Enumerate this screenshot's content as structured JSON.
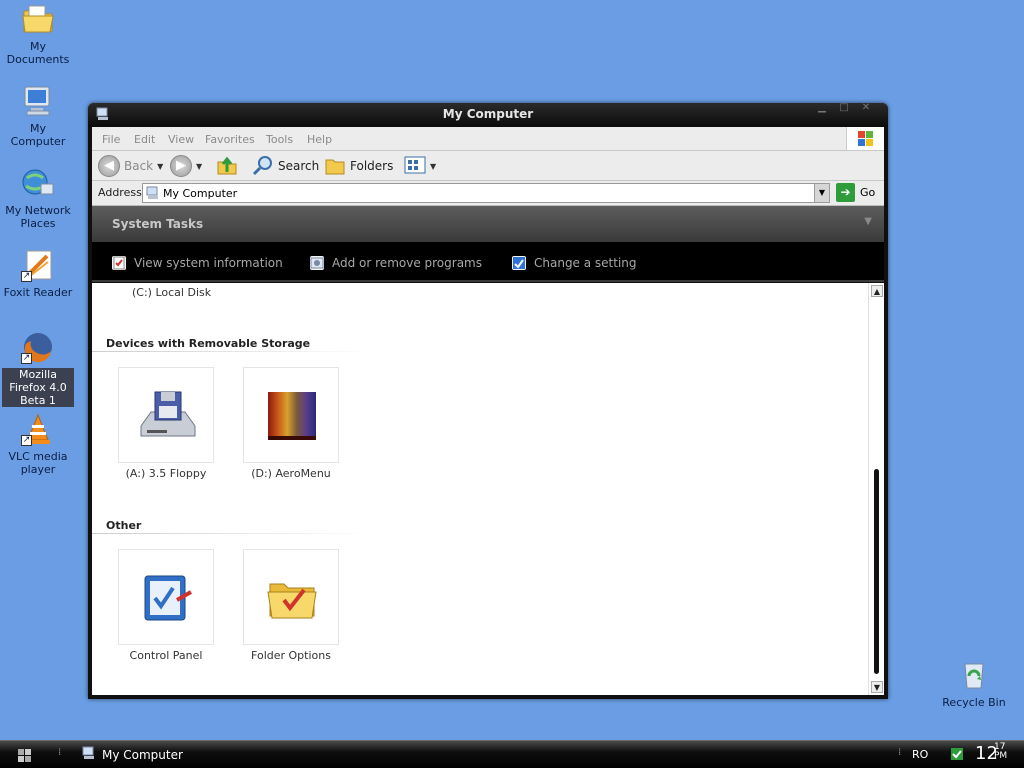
{
  "desktop": {
    "icons": [
      {
        "label": "My Documents",
        "icon": "folder-documents-icon"
      },
      {
        "label": "My Computer",
        "icon": "computer-icon"
      },
      {
        "label": "My Network Places",
        "icon": "network-places-icon"
      },
      {
        "label": "Foxit Reader",
        "icon": "foxit-reader-icon"
      },
      {
        "label": "Mozilla Firefox 4.0 Beta 1",
        "icon": "firefox-icon"
      },
      {
        "label": "VLC media player",
        "icon": "vlc-icon"
      },
      {
        "label": "Recycle Bin",
        "icon": "recycle-bin-icon"
      }
    ],
    "background_color": "#6a9de3"
  },
  "window": {
    "title": "My Computer",
    "menu": [
      "File",
      "Edit",
      "View",
      "Favorites",
      "Tools",
      "Help"
    ],
    "toolbar": {
      "back": "Back",
      "search": "Search",
      "folders": "Folders"
    },
    "address": {
      "label": "Address",
      "value": "My Computer",
      "go": "Go"
    },
    "system_tasks": {
      "title": "System Tasks",
      "items": [
        "View system information",
        "Add or remove programs",
        "Change a setting"
      ]
    },
    "content": {
      "hard_disk_label": "(C:) Local Disk",
      "groups": [
        {
          "title": "Devices with Removable Storage",
          "items": [
            {
              "label": "(A:) 3.5 Floppy",
              "icon": "floppy-drive-icon"
            },
            {
              "label": "(D:) AeroMenu",
              "icon": "cd-drive-icon"
            }
          ]
        },
        {
          "title": "Other",
          "items": [
            {
              "label": "Control Panel",
              "icon": "control-panel-icon"
            },
            {
              "label": "Folder Options",
              "icon": "folder-options-icon"
            }
          ]
        }
      ]
    }
  },
  "taskbar": {
    "task_label": "My Computer",
    "language": "RO",
    "clock_hour": "12",
    "clock_minute": "17",
    "clock_ampm": "PM"
  }
}
